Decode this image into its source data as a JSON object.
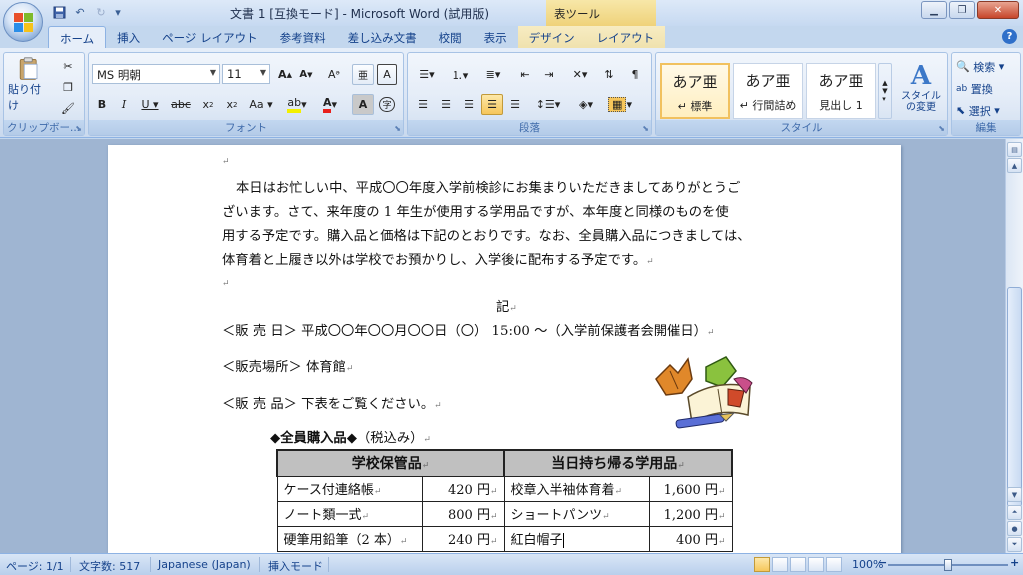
{
  "window": {
    "title": "文書 1 [互換モード] - Microsoft Word (試用版)",
    "context_tab_title": "表ツール"
  },
  "tabs": [
    "ホーム",
    "挿入",
    "ページ レイアウト",
    "参考資料",
    "差し込み文書",
    "校閲",
    "表示",
    "デザイン",
    "レイアウト"
  ],
  "ribbon": {
    "clipboard": {
      "label": "クリップボー...",
      "paste": "貼り付け"
    },
    "font": {
      "label": "フォント",
      "name": "MS 明朝",
      "size": "11"
    },
    "paragraph": {
      "label": "段落"
    },
    "styles": {
      "label": "スタイル",
      "items": [
        {
          "sample": "あア亜",
          "name": "↵ 標準"
        },
        {
          "sample": "あア亜",
          "name": "↵ 行間詰め"
        },
        {
          "sample": "あア亜",
          "name": "見出し 1"
        }
      ],
      "change": "スタイルの変更"
    },
    "editing": {
      "label": "編集",
      "find": "検索",
      "replace": "置換",
      "select": "選択"
    }
  },
  "document": {
    "lines": [
      "本日はお忙しい中、平成〇〇年度入学前検診にお集まりいただきましてありがとうご",
      "ざいます。さて、来年度の 1 年生が使用する学用品ですが、本年度と同様のものを使",
      "用する予定です。購入品と価格は下記のとおりです。なお、全員購入品につきましては、",
      "体育着と上履き以外は学校でお預かりし、入学後に配布する予定です。"
    ],
    "ki": "記",
    "sale_date": "＜販 売 日＞ 平成〇〇年〇〇月〇〇日（〇） 15:00 ～（入学前保護者会開催日）",
    "sale_place": "＜販売場所＞ 体育館",
    "sale_items": "＜販 売 品＞ 下表をご覧ください。",
    "table_caption_bold": "◆全員購入品◆",
    "table_caption_rest": "（税込み）",
    "table": {
      "headers": [
        "学校保管品",
        "当日持ち帰る学用品"
      ],
      "rows": [
        [
          "ケース付連絡帳",
          "420 円",
          "校章入半袖体育着",
          "1,600 円"
        ],
        [
          "ノート類一式",
          "800 円",
          "ショートパンツ",
          "1,200 円"
        ],
        [
          "硬筆用鉛筆（2 本）",
          "240 円",
          "紅白帽子",
          "400 円"
        ]
      ]
    }
  },
  "statusbar": {
    "page": "ページ: 1/1",
    "words": "文字数: 517",
    "language": "Japanese (Japan)",
    "mode": "挿入モード",
    "zoom": "100%"
  }
}
